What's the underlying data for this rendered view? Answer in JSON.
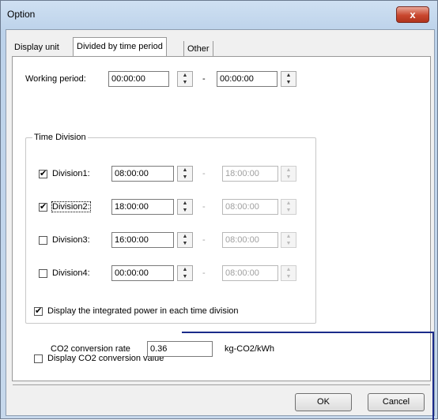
{
  "window": {
    "title": "Option",
    "close_label": "x"
  },
  "tabs": [
    {
      "label": "Display unit",
      "active": false
    },
    {
      "label": "Divided by time period",
      "active": true
    },
    {
      "label": "Other",
      "active": false
    }
  ],
  "working_period": {
    "label": "Working period:",
    "start": "00:00:00",
    "separator": "-",
    "end": "00:00:00"
  },
  "time_division": {
    "title": "Time Division",
    "rows": [
      {
        "label": "Division1:",
        "checked": true,
        "start": "08:00:00",
        "separator": "-",
        "end": "18:00:00",
        "end_enabled": false
      },
      {
        "label": "Division2:",
        "checked": true,
        "start": "18:00:00",
        "separator": "-",
        "end": "08:00:00",
        "end_enabled": false
      },
      {
        "label": "Division3:",
        "checked": false,
        "start": "16:00:00",
        "separator": "-",
        "end": "08:00:00",
        "end_enabled": false
      },
      {
        "label": "Division4:",
        "checked": false,
        "start": "00:00:00",
        "separator": "-",
        "end": "08:00:00",
        "end_enabled": false
      }
    ]
  },
  "integrated_power": {
    "label": "Display the integrated power in each time division",
    "checked": true
  },
  "co2": {
    "label": "Display CO2 conversion value",
    "checked": false,
    "rate_label": "CO2 conversion rate",
    "rate_value": "0.36",
    "unit": "kg-CO2/kWh"
  },
  "buttons": {
    "ok": "OK",
    "cancel": "Cancel"
  },
  "colors": {
    "leader_line": "#1a2b8a",
    "close_button": "#c9472e"
  }
}
